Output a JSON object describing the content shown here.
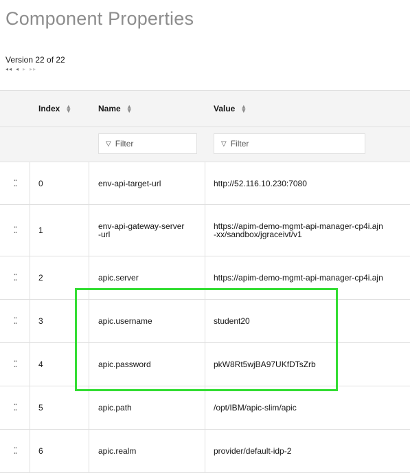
{
  "page": {
    "title": "Component Properties"
  },
  "version": {
    "label": "Version 22 of 22"
  },
  "version_nav": {
    "first": "◂◂",
    "prev": "◂",
    "next": "▸",
    "last": "▸▸"
  },
  "table": {
    "columns": {
      "index": "Index",
      "name": "Name",
      "value": "Value"
    },
    "filters": {
      "name_placeholder": "Filter",
      "value_placeholder": "Filter",
      "filter_icon": "funnel-icon"
    },
    "rows": [
      {
        "index": "0",
        "name": "env-api-target-url",
        "value": "http://52.116.10.230:7080"
      },
      {
        "index": "1",
        "name": "env-api-gateway-server-url",
        "name_line1": "env-api-gateway-server",
        "name_line2": "-url",
        "value": "https://apim-demo-mgmt-api-manager-cp4i.ajn-xx/sandbox/jgraceivt/v1",
        "value_line1": "https://apim-demo-mgmt-api-manager-cp4i.ajn",
        "value_line2": "-xx/sandbox/jgraceivt/v1"
      },
      {
        "index": "2",
        "name": "apic.server",
        "value": "https://apim-demo-mgmt-api-manager-cp4i.ajn"
      },
      {
        "index": "3",
        "name": "apic.username",
        "value": "student20"
      },
      {
        "index": "4",
        "name": "apic.password",
        "value": "pkW8Rt5wjBA97UKfDTsZrb"
      },
      {
        "index": "5",
        "name": "apic.path",
        "value": "/opt/IBM/apic-slim/apic"
      },
      {
        "index": "6",
        "name": "apic.realm",
        "value": "provider/default-idp-2"
      }
    ]
  },
  "highlight": {
    "color": "#33dd33"
  }
}
